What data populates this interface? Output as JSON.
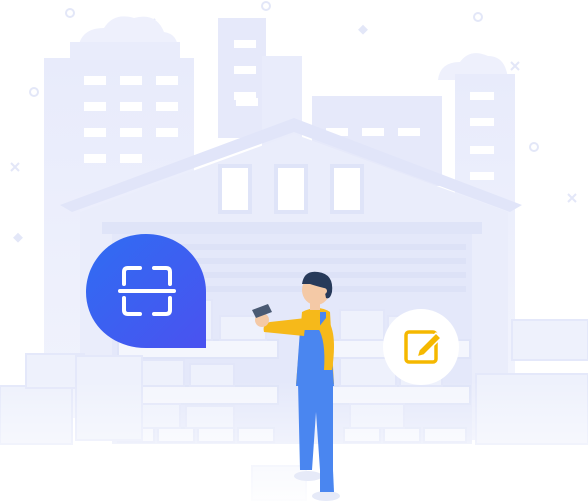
{
  "illustration": {
    "subject": "warehouse-worker-scanning",
    "icons": [
      "scan-icon",
      "edit-icon"
    ],
    "colors": {
      "background": "#ffffff",
      "building": "#e9ecfb",
      "building_shadow": "#dde2f8",
      "window": "#ffffff",
      "scan_bubble_start": "#2f6df2",
      "scan_bubble_end": "#4a52f0",
      "edit_badge": "#f5b800",
      "worker_overalls": "#4a86f0",
      "worker_shirt": "#f6b91a",
      "worker_skin": "#f4c9a6",
      "worker_hair": "#273a5a"
    }
  }
}
